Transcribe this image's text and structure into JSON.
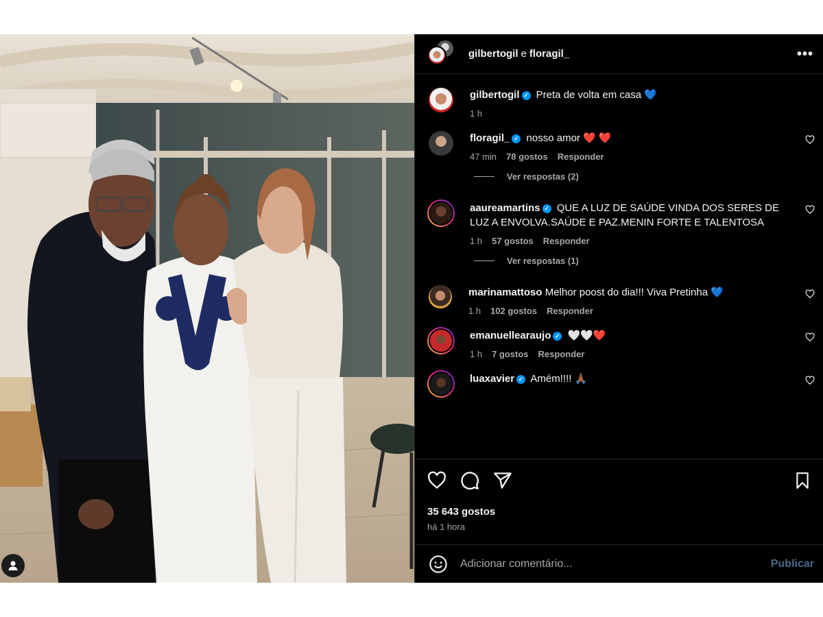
{
  "header": {
    "user1": "gilbertogil",
    "joiner": "e",
    "user2": "floragil_",
    "more": "•••"
  },
  "caption": {
    "user": "gilbertogil",
    "text": "Preta de volta em casa",
    "emoji": "💙",
    "time": "1 h"
  },
  "comments": [
    {
      "user": "floragil_",
      "text": "nosso amor",
      "emoji": "❤️ ❤️",
      "time": "47 min",
      "likes": "78 gostos",
      "reply": "Responder",
      "replies": "Ver respostas (2)"
    },
    {
      "user": "aaureamartins",
      "text": "QUE A LUZ DE SAÚDE VINDA DOS SERES DE LUZ A ENVOLVA.SAÚDE E PAZ.MENIN FORTE E TALENTOSA",
      "emoji": "",
      "time": "1 h",
      "likes": "57 gostos",
      "reply": "Responder",
      "replies": "Ver respostas (1)"
    },
    {
      "user": "marinamattoso",
      "text": "Melhor poost do dia!!! Viva Pretinha",
      "emoji": "💙",
      "time": "1 h",
      "likes": "102 gostos",
      "reply": "Responder"
    },
    {
      "user": "emanuellearaujo",
      "text": "",
      "emoji": "🤍🤍❤️",
      "time": "1 h",
      "likes": "7 gostos",
      "reply": "Responder"
    },
    {
      "user": "luaxavier",
      "text": "Amém!!!!",
      "emoji": "🙏🏾",
      "time": "",
      "likes": "",
      "reply": ""
    }
  ],
  "post": {
    "likes": "35 643 gostos",
    "posted": "há 1 hora"
  },
  "composer": {
    "placeholder": "Adicionar comentário...",
    "publish": "Publicar"
  },
  "icons": {
    "like": "heart-icon",
    "comment": "comment-icon",
    "share": "share-icon",
    "save": "bookmark-icon",
    "emoji": "emoji-icon",
    "tag": "user-tag-icon"
  },
  "colors": {
    "panel_bg": "#000000",
    "text": "#f5f5f5",
    "muted": "#a8a8a8",
    "verified": "#0095f6",
    "publish_disabled": "#4a6a89"
  }
}
